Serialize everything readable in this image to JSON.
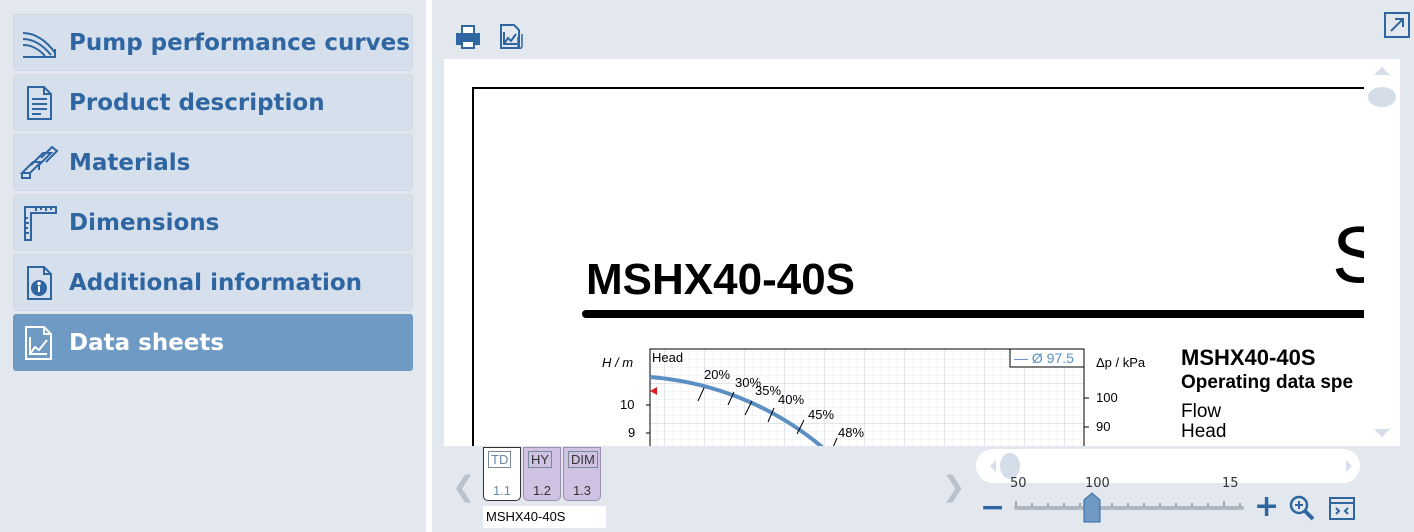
{
  "sidebar": {
    "items": [
      {
        "label": "Pump performance curves",
        "icon": "pump-curve-icon",
        "active": false
      },
      {
        "label": "Product description",
        "icon": "document-icon",
        "active": false
      },
      {
        "label": "Materials",
        "icon": "materials-icon",
        "active": false
      },
      {
        "label": "Dimensions",
        "icon": "ruler-icon",
        "active": false
      },
      {
        "label": "Additional information",
        "icon": "info-document-icon",
        "active": false
      },
      {
        "label": "Data sheets",
        "icon": "data-sheet-icon",
        "active": true
      }
    ]
  },
  "toolbar": {
    "print_icon": "print-icon",
    "export_icon": "export-image-icon",
    "expand_icon": "expand-icon"
  },
  "document": {
    "title": "MSHX40-40S",
    "big_letter": "S",
    "chart": {
      "head_label": "Head",
      "y_label": "H / m",
      "y2_label": "Δp / kPa",
      "diameter_label": "— Ø 97.5",
      "y_ticks": [
        "10",
        "9"
      ],
      "y2_ticks": [
        "100",
        "90"
      ],
      "efficiency_labels": [
        "20%",
        "30%",
        "35%",
        "40%",
        "45%",
        "48%"
      ]
    },
    "operating": {
      "title": "MSHX40-40S",
      "subtitle": "Operating data spe",
      "rows": [
        "Flow",
        "Head"
      ]
    }
  },
  "thumbnails": [
    {
      "tag": "TD",
      "number": "1.1",
      "active": true
    },
    {
      "tag": "HY",
      "number": "1.2",
      "active": false
    },
    {
      "tag": "DIM",
      "number": "1.3",
      "active": false
    }
  ],
  "file_name": "MSHX40-40S",
  "zoom": {
    "ticks": [
      "50",
      "100",
      "15"
    ],
    "minus": "−",
    "plus": "+",
    "level": 100
  },
  "colors": {
    "accent": "#2f66a1",
    "active_bg": "#6e9ac3",
    "curve": "#5b8fc4",
    "marker": "#e02020"
  }
}
